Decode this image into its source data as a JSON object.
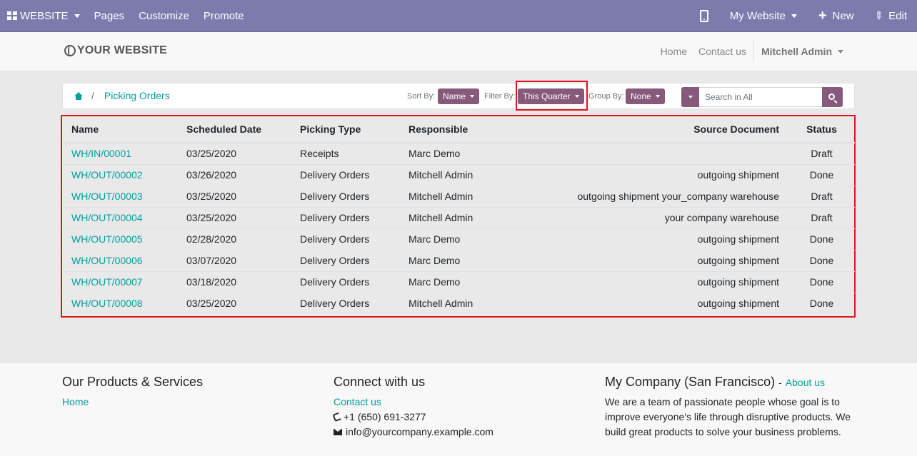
{
  "topbar": {
    "website_label": "WEBSITE",
    "menu": [
      "Pages",
      "Customize",
      "Promote"
    ],
    "site_selector": "My Website",
    "new_label": "New",
    "edit_label": "Edit"
  },
  "header": {
    "logo_text": "YOUR WEBSITE",
    "nav": [
      "Home",
      "Contact us"
    ],
    "user": "Mitchell Admin"
  },
  "controls": {
    "breadcrumb": "Picking Orders",
    "sort_label": "Sort By:",
    "sort_value": "Name",
    "filter_label": "Filter By:",
    "filter_value": "This Quarter",
    "group_label": "Group By:",
    "group_value": "None",
    "search_placeholder": "Search in All"
  },
  "table": {
    "headers": {
      "name": "Name",
      "date": "Scheduled Date",
      "type": "Picking Type",
      "responsible": "Responsible",
      "source": "Source Document",
      "status": "Status"
    },
    "rows": [
      {
        "name": "WH/IN/00001",
        "date": "03/25/2020",
        "type": "Receipts",
        "responsible": "Marc Demo",
        "source": "",
        "status": "Draft"
      },
      {
        "name": "WH/OUT/00002",
        "date": "03/26/2020",
        "type": "Delivery Orders",
        "responsible": "Mitchell Admin",
        "source": "outgoing shipment",
        "status": "Done"
      },
      {
        "name": "WH/OUT/00003",
        "date": "03/25/2020",
        "type": "Delivery Orders",
        "responsible": "Mitchell Admin",
        "source": "outgoing shipment your_company warehouse",
        "status": "Draft"
      },
      {
        "name": "WH/OUT/00004",
        "date": "03/25/2020",
        "type": "Delivery Orders",
        "responsible": "Mitchell Admin",
        "source": "your company warehouse",
        "status": "Draft"
      },
      {
        "name": "WH/OUT/00005",
        "date": "02/28/2020",
        "type": "Delivery Orders",
        "responsible": "Marc Demo",
        "source": "outgoing shipment",
        "status": "Done"
      },
      {
        "name": "WH/OUT/00006",
        "date": "03/07/2020",
        "type": "Delivery Orders",
        "responsible": "Marc Demo",
        "source": "outgoing shipment",
        "status": "Done"
      },
      {
        "name": "WH/OUT/00007",
        "date": "03/18/2020",
        "type": "Delivery Orders",
        "responsible": "Marc Demo",
        "source": "outgoing shipment",
        "status": "Done"
      },
      {
        "name": "WH/OUT/00008",
        "date": "03/25/2020",
        "type": "Delivery Orders",
        "responsible": "Mitchell Admin",
        "source": "outgoing shipment",
        "status": "Done"
      }
    ]
  },
  "footer": {
    "products_title": "Our Products & Services",
    "products_link": "Home",
    "connect_title": "Connect with us",
    "contact_link": "Contact us",
    "phone": "+1 (650) 691-3277",
    "email": "info@yourcompany.example.com",
    "company_title": "My Company (San Francisco)",
    "about_separator": "-",
    "about_link": "About us",
    "company_text": "We are a team of passionate people whose goal is to improve everyone's life through disruptive products. We build great products to solve your business problems."
  },
  "colors": {
    "topbar": "#7c7bad",
    "accent_link": "#00a09d",
    "button": "#875a7b",
    "highlight": "#e0141e"
  },
  "icons": [
    "apps-grid-icon",
    "mobile-icon",
    "plus-icon",
    "pencil-icon",
    "globe-icon",
    "home-icon",
    "search-icon",
    "phone-icon",
    "envelope-icon"
  ]
}
